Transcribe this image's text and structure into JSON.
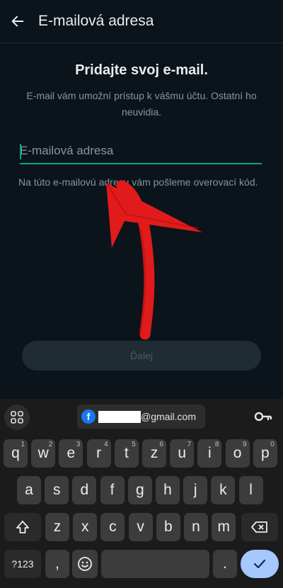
{
  "header": {
    "title": "E-mailová adresa"
  },
  "content": {
    "heading": "Pridajte svoj e-mail.",
    "subtext": "E-mail vám umožní prístup k vášmu účtu. Ostatní ho neuvidia.",
    "email_placeholder": "E-mailová adresa",
    "hint": "Na túto e-mailovú adresu vám pošleme overovací kód.",
    "next_label": "Ďalej"
  },
  "keyboard": {
    "suggestion_text": "@gmail.com",
    "row1": [
      {
        "label": "q",
        "num": "1"
      },
      {
        "label": "w",
        "num": "2"
      },
      {
        "label": "e",
        "num": "3"
      },
      {
        "label": "r",
        "num": "4"
      },
      {
        "label": "t",
        "num": "5"
      },
      {
        "label": "z",
        "num": "6"
      },
      {
        "label": "u",
        "num": "7"
      },
      {
        "label": "i",
        "num": "8"
      },
      {
        "label": "o",
        "num": "9"
      },
      {
        "label": "p",
        "num": "0"
      }
    ],
    "row2": [
      "a",
      "s",
      "d",
      "f",
      "g",
      "h",
      "j",
      "k",
      "l"
    ],
    "row3": [
      "z",
      "x",
      "c",
      "v",
      "b",
      "n",
      "m"
    ],
    "symbols_label": "?123",
    "comma_label": ",",
    "period_label": "."
  },
  "colors": {
    "accent": "#00a884",
    "background": "#0b141a",
    "annotation_arrow": "#e11b1b"
  },
  "icons": {
    "back": "back-arrow-icon",
    "grid": "apps-grid-icon",
    "password": "key-icon",
    "facebook": "facebook-icon",
    "shift": "shift-icon",
    "backspace": "backspace-icon",
    "emoji": "emoji-icon",
    "enter": "checkmark-icon"
  }
}
